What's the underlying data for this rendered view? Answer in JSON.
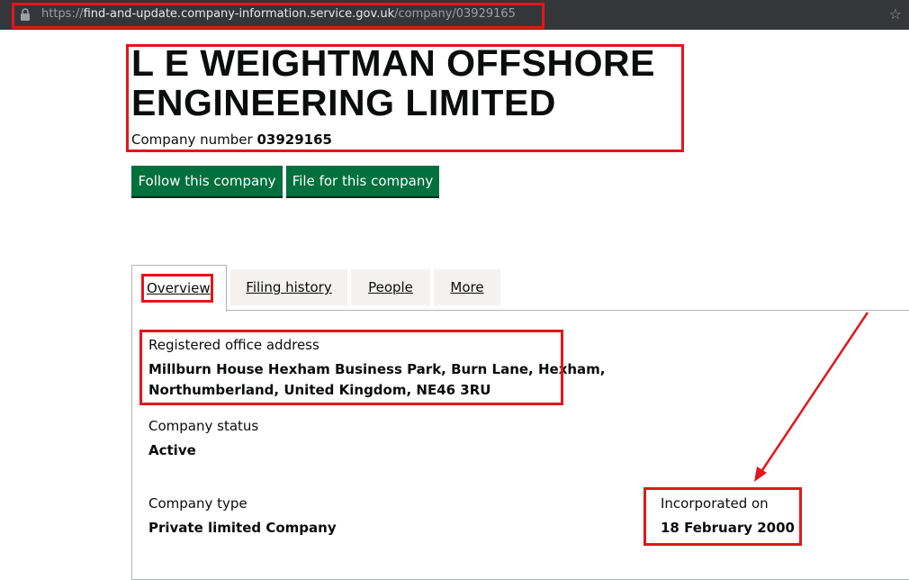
{
  "browser": {
    "url_scheme": "https://",
    "url_host": "find-and-update.company-information.service.gov.uk",
    "url_path": "/company/03929165"
  },
  "company": {
    "name": "L E WEIGHTMAN OFFSHORE ENGINEERING LIMITED",
    "number_label": "Company number",
    "number": "03929165"
  },
  "actions": {
    "follow_label": "Follow this company",
    "file_label": "File for this company"
  },
  "tabs": [
    {
      "label": "Overview",
      "active": true
    },
    {
      "label": "Filing history",
      "active": false
    },
    {
      "label": "People",
      "active": false
    },
    {
      "label": "More",
      "active": false
    }
  ],
  "overview": {
    "address_label": "Registered office address",
    "address_line1": "Millburn House Hexham Business Park, Burn Lane, Hexham,",
    "address_line2": "Northumberland, United Kingdom, NE46 3RU",
    "status_label": "Company status",
    "status": "Active",
    "type_label": "Company type",
    "type": "Private limited Company",
    "incorporated_label": "Incorporated on",
    "incorporated": "18 February 2000"
  },
  "colors": {
    "accent_green": "#00703c",
    "annotation_red": "#e3161b",
    "address_bar": "#35363a"
  }
}
